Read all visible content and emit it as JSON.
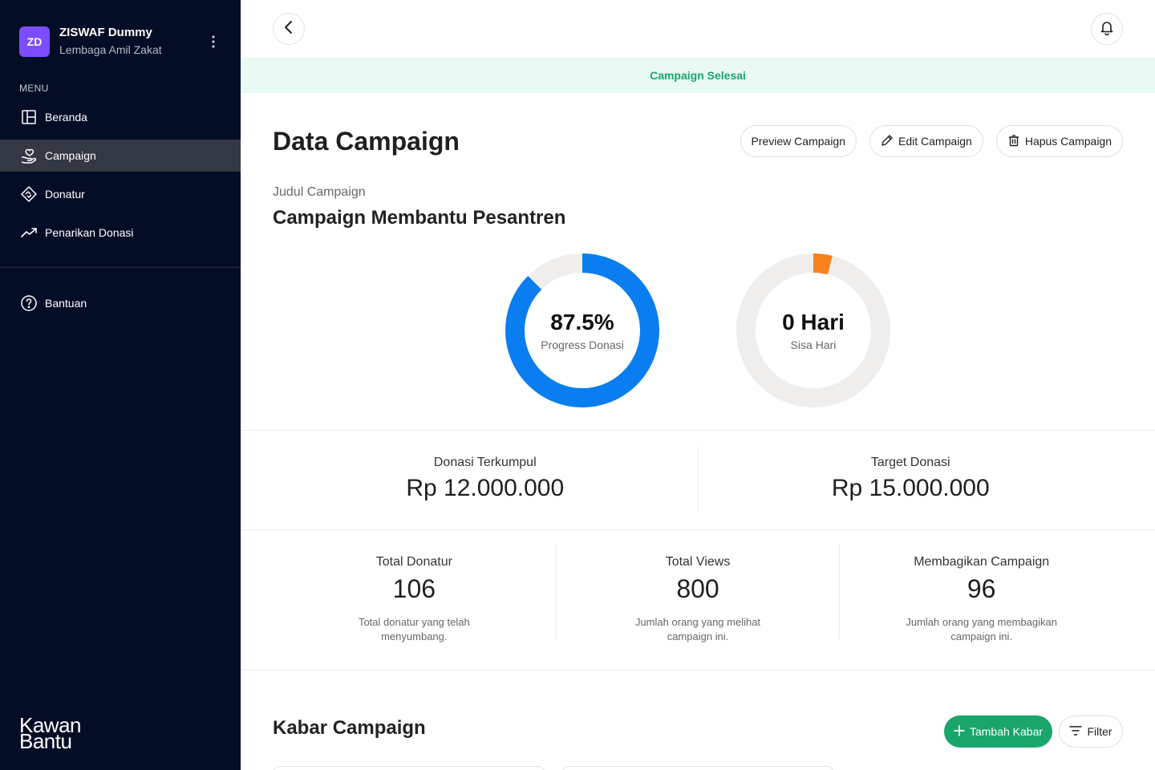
{
  "sidebar": {
    "org_initials": "ZD",
    "org_name": "ZISWAF Dummy",
    "org_subtitle": "Lembaga Amil Zakat",
    "menu_heading": "MENU",
    "items": [
      {
        "label": "Beranda",
        "icon": "layout-icon",
        "active": false
      },
      {
        "label": "Campaign",
        "icon": "hand-heart-icon",
        "active": true
      },
      {
        "label": "Donatur",
        "icon": "handshake-icon",
        "active": false
      },
      {
        "label": "Penarikan Donasi",
        "icon": "trending-up-icon",
        "active": false
      }
    ],
    "help_label": "Bantuan",
    "brand_line1": "Kawan",
    "brand_line2": "Bantu"
  },
  "banner": {
    "text": "Campaign Selesai"
  },
  "page": {
    "title": "Data Campaign",
    "actions": {
      "preview": "Preview Campaign",
      "edit": "Edit Campaign",
      "delete": "Hapus Campaign"
    },
    "campaign_label": "Judul Campaign",
    "campaign_title": "Campaign Membantu Pesantren"
  },
  "progress": {
    "value_text": "87.5%",
    "label": "Progress Donasi",
    "fraction": 0.875,
    "color": "#0a7ef0"
  },
  "remaining": {
    "value_text": "0 Hari",
    "label": "Sisa Hari",
    "fraction": 0.04,
    "color": "#f7821e"
  },
  "donations": {
    "collected_label": "Donasi Terkumpul",
    "collected_value": "Rp 12.000.000",
    "target_label": "Target Donasi",
    "target_value": "Rp 15.000.000"
  },
  "stats": [
    {
      "label": "Total Donatur",
      "value": "106",
      "desc": "Total donatur yang telah menyumbang."
    },
    {
      "label": "Total Views",
      "value": "800",
      "desc": "Jumlah orang yang melihat campaign ini."
    },
    {
      "label": "Membagikan Campaign",
      "value": "96",
      "desc": "Jumlah orang yang membagikan campaign ini."
    }
  ],
  "news": {
    "title": "Kabar Campaign",
    "add_button": "Tambah Kabar",
    "filter_button": "Filter"
  },
  "colors": {
    "sidebar_bg": "#040d26",
    "accent_green": "#1aa56b",
    "track": "#f0eeec"
  }
}
